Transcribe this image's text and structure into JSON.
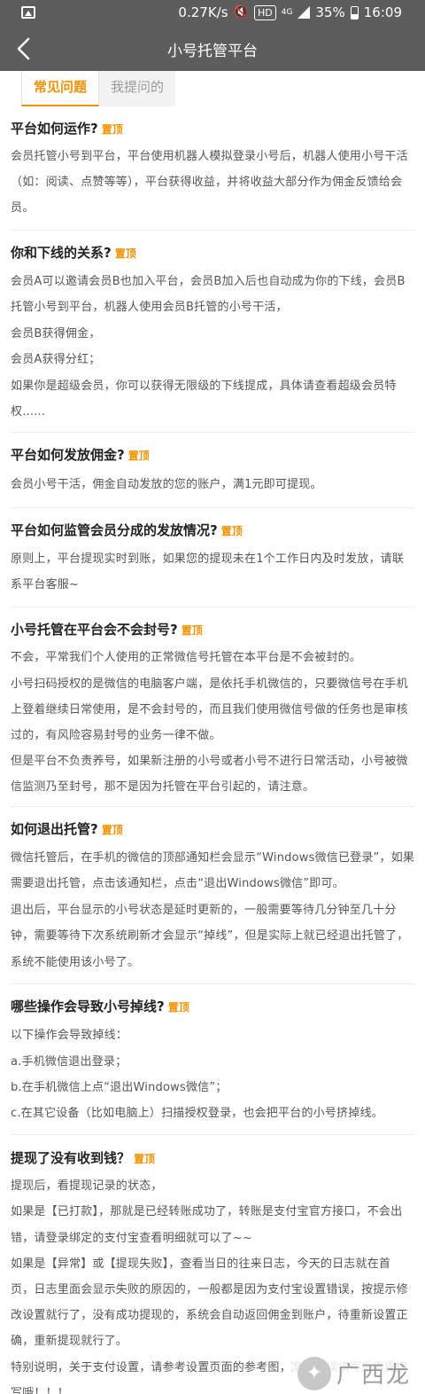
{
  "status_bar": {
    "net_speed": "0.27K/s",
    "hd": "HD",
    "signal": "4G",
    "battery": "35%",
    "time": "16:09"
  },
  "nav": {
    "title": "小号托管平台"
  },
  "tabs": [
    {
      "label": "常见问题",
      "active": true
    },
    {
      "label": "我提问的",
      "active": false
    }
  ],
  "pin_label": "置顶",
  "faqs": [
    {
      "title": "平台如何运作?",
      "lines": [
        "会员托管小号到平台，平台使用机器人模拟登录小号后，机器人使用小号干活",
        "（如：阅读、点赞等等），平台获得收益，并将收益大部分作为佣金反馈给会",
        "员。"
      ]
    },
    {
      "title": "你和下线的关系?",
      "lines": [
        "会员A可以邀请会员B也加入平台，会员B加入后也自动成为你的下线，会员B",
        "托管小号到平台，机器人使用会员B托管的小号干活，",
        "会员B获得佣金，",
        "会员A获得分红；",
        "如果你是超级会员，你可以获得无限级的下线提成，具体请查看超级会员特",
        "权......"
      ]
    },
    {
      "title": "平台如何发放佣金?",
      "lines": [
        "会员小号干活，佣金自动发放的您的账户，满1元即可提现。"
      ]
    },
    {
      "title": "平台如何监管会员分成的发放情况?",
      "lines": [
        "原则上，平台提现实时到账，如果您的提现未在1个工作日内及时发放，请联",
        "系平台客服~"
      ]
    },
    {
      "title": "小号托管在平台会不会封号?",
      "lines": [
        "不会，平常我们个人使用的正常微信号托管在本平台是不会被封的。",
        "小号扫码授权的是微信的电脑客户端，是依托手机微信的，只要微信号在手机",
        "上登着继续日常使用，是不会封号的，而且我们使用微信号做的任务也是审核",
        "过的，有风险容易封号的业务一律不做。",
        "但是平台不负责养号，如果新注册的小号或者小号不进行日常活动，小号被微",
        "信监测乃至封号，那不是因为托管在平台引起的，请注意。"
      ]
    },
    {
      "title": "如何退出托管?",
      "lines": [
        "微信托管后，在手机的微信的顶部通知栏会显示“Windows微信已登录”，如果",
        "需要退出托管，点击该通知栏，点击“退出Windows微信”即可。",
        "退出后，平台显示的小号状态是延时更新的，一般需要等待几分钟至几十分",
        "钟，需要等待下次系统刷新才会显示“掉线”，但是实际上就已经退出托管了，",
        "系统不能使用该小号了。"
      ]
    },
    {
      "title": "哪些操作会导致小号掉线?",
      "lines": [
        "以下操作会导致掉线：",
        "a.手机微信退出登录；",
        "b.在手机微信上点“退出Windows微信”；",
        "c.在其它设备（比如电脑上）扫描授权登录，也会把平台的小号挤掉线。"
      ]
    },
    {
      "title": "提现了没有收到钱？",
      "lines": [
        "提现后，看提现记录的状态，",
        "如果是【已打款】，那就是已经转账成功了，转账是支付宝官方接口，不会出",
        "错，请登录绑定的支付宝查看明细就可以了~~",
        "如果是【异常】或【提现失败】，查看当日的往来日志，今天的日志就在首",
        "页，日志里面会显示失败的原因的，一般都是因为支付宝设置错误，按提示修",
        "改设置就行了，没有成功提现的，系统会自动返回佣金到账户，待重新设置正",
        "确，重新提现就行了。",
        "特别说明，关于支付设置，请参考设置页面的参考图，准确无误填写后再提填",
        "写哦！！！"
      ]
    }
  ],
  "watermark": {
    "text": "广西龙网"
  }
}
